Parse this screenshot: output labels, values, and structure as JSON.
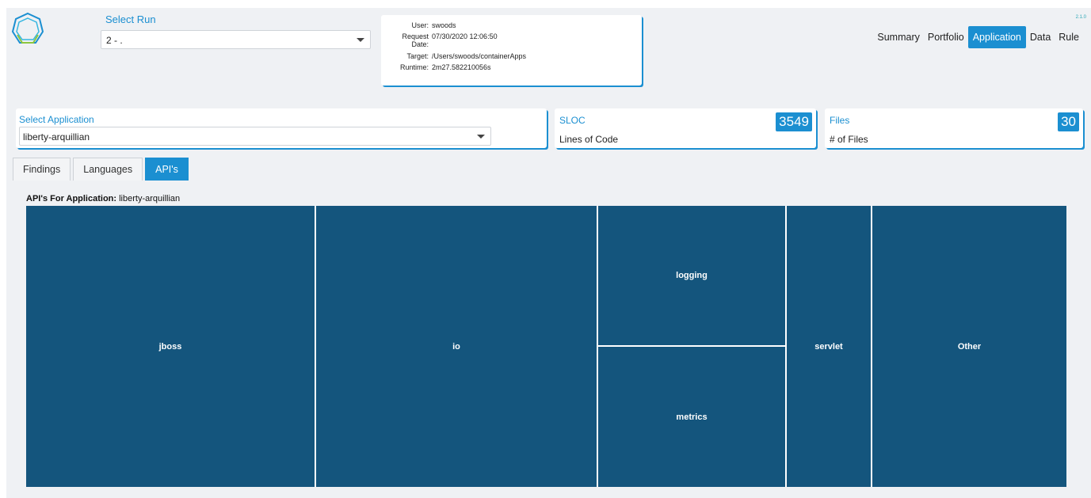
{
  "header": {
    "run_label": "Select Run",
    "run_value": "2 - .",
    "version": "2.1.0"
  },
  "run_info": {
    "rows": [
      {
        "key": "User:",
        "value": "swoods"
      },
      {
        "key": "Request Date:",
        "value": "07/30/2020 12:06:50"
      },
      {
        "key": "Target:",
        "value": "/Users/swoods/containerApps"
      },
      {
        "key": "Runtime:",
        "value": "2m27.582210056s"
      }
    ]
  },
  "nav": {
    "items": [
      "Summary",
      "Portfolio",
      "Application",
      "Data",
      "Rule"
    ],
    "active": "Application"
  },
  "application": {
    "label": "Select Application",
    "value": "liberty-arquillian"
  },
  "sloc": {
    "title": "SLOC",
    "value": "3549",
    "subtitle": "Lines of Code"
  },
  "files": {
    "title": "Files",
    "value": "30",
    "subtitle": "# of Files"
  },
  "tabs": {
    "items": [
      "Findings",
      "Languages",
      "API's"
    ],
    "active": "API's"
  },
  "chart_data": {
    "type": "treemap",
    "title_prefix": "API's For Application:",
    "title_app": "liberty-arquillian",
    "color": "#14557d",
    "items": [
      {
        "name": "jboss"
      },
      {
        "name": "io"
      },
      {
        "name": "logging"
      },
      {
        "name": "metrics"
      },
      {
        "name": "servlet"
      },
      {
        "name": "Other"
      }
    ]
  }
}
